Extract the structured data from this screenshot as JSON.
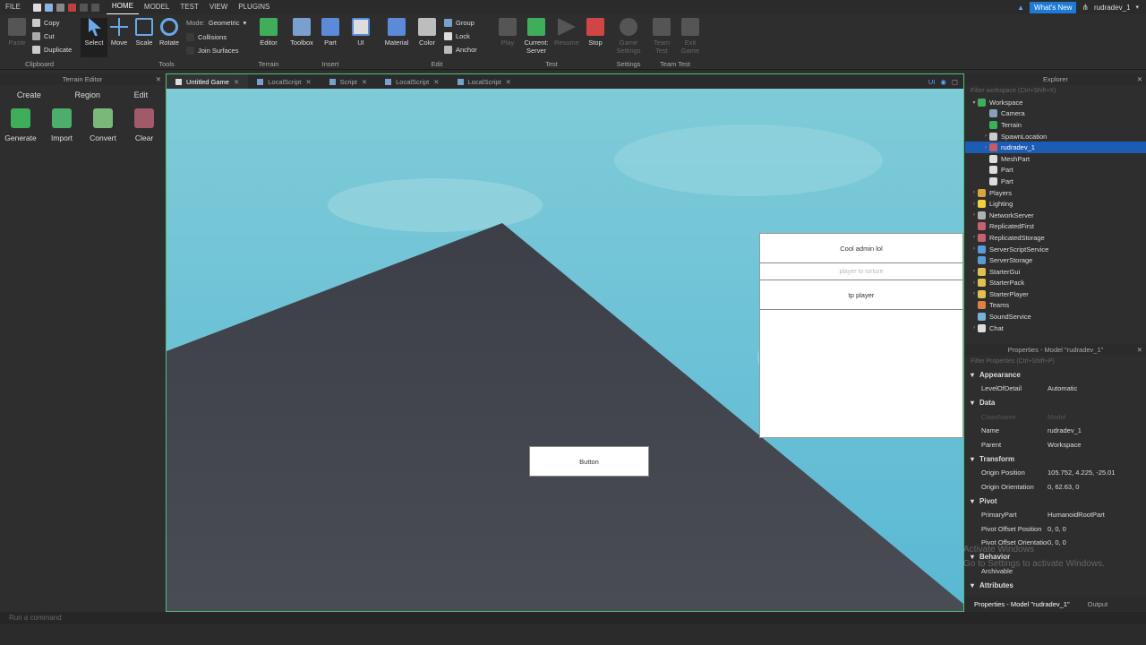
{
  "topbar": {
    "menu": [
      "FILE",
      "HOME",
      "MODEL",
      "TEST",
      "VIEW",
      "PLUGINS"
    ],
    "active_menu": "HOME",
    "whats_new": "What's New",
    "username": "rudradev_1"
  },
  "ribbon": {
    "clipboard": {
      "label": "Clipboard",
      "paste": "Paste",
      "copy": "Copy",
      "cut": "Cut",
      "duplicate": "Duplicate"
    },
    "tools": {
      "label": "Tools",
      "select": "Select",
      "move": "Move",
      "scale": "Scale",
      "rotate": "Rotate",
      "mode_label": "Mode:",
      "mode_value": "Geometric",
      "collisions": "Collisions",
      "join_surfaces": "Join Surfaces"
    },
    "terrain": {
      "label": "Terrain",
      "editor": "Editor"
    },
    "insert": {
      "label": "Insert",
      "toolbox": "Toolbox",
      "part": "Part",
      "ui": "UI"
    },
    "edit": {
      "label": "Edit",
      "material": "Material",
      "color": "Color",
      "group": "Group",
      "lock": "Lock",
      "anchor": "Anchor"
    },
    "test": {
      "label": "Test",
      "play": "Play",
      "current_server": "Current:",
      "server": "Server",
      "resume": "Resume",
      "stop": "Stop"
    },
    "settings": {
      "label": "Settings",
      "game_settings": "Game Settings"
    },
    "team_test": {
      "label": "Team Test",
      "team_test": "Team Test",
      "exit_game": "Exit Game"
    }
  },
  "terrain_editor": {
    "title": "Terrain Editor",
    "tabs": [
      "Create",
      "Region",
      "Edit"
    ],
    "tools": [
      "Generate",
      "Import",
      "Convert",
      "Clear"
    ]
  },
  "doc_tabs": [
    {
      "label": "Untitled Game",
      "active": true
    },
    {
      "label": "LocalScript",
      "active": false
    },
    {
      "label": "Script",
      "active": false
    },
    {
      "label": "LocalScript",
      "active": false
    },
    {
      "label": "LocalScript",
      "active": false
    }
  ],
  "viewport": {
    "ui_toggle": "UI",
    "admin_panel": {
      "title": "Cool admin lol",
      "placeholder": "player to torture",
      "tp_button": "tp player"
    },
    "game_button": "Button"
  },
  "explorer": {
    "title": "Explorer",
    "filter_placeholder": "Filter workspace (Ctrl+Shift+X)",
    "items": [
      {
        "label": "Workspace",
        "depth": 0,
        "arrow": "▾",
        "color": "#3fae5a",
        "selected": false
      },
      {
        "label": "Camera",
        "depth": 1,
        "arrow": "",
        "color": "#8aa0b8",
        "selected": false
      },
      {
        "label": "Terrain",
        "depth": 1,
        "arrow": "",
        "color": "#3fae5a",
        "selected": false
      },
      {
        "label": "SpawnLocation",
        "depth": 1,
        "arrow": "›",
        "color": "#cccccc",
        "selected": false
      },
      {
        "label": "rudradev_1",
        "depth": 1,
        "arrow": "›",
        "color": "#c85a6a",
        "selected": true
      },
      {
        "label": "MeshPart",
        "depth": 1,
        "arrow": "",
        "color": "#dddddd",
        "selected": false
      },
      {
        "label": "Part",
        "depth": 1,
        "arrow": "",
        "color": "#dddddd",
        "selected": false
      },
      {
        "label": "Part",
        "depth": 1,
        "arrow": "",
        "color": "#dddddd",
        "selected": false
      },
      {
        "label": "Players",
        "depth": 0,
        "arrow": "›",
        "color": "#d9a43a",
        "selected": false
      },
      {
        "label": "Lighting",
        "depth": 0,
        "arrow": "›",
        "color": "#f0d040",
        "selected": false
      },
      {
        "label": "NetworkServer",
        "depth": 0,
        "arrow": "›",
        "color": "#b0b0b0",
        "selected": false
      },
      {
        "label": "ReplicatedFirst",
        "depth": 0,
        "arrow": "",
        "color": "#c86070",
        "selected": false
      },
      {
        "label": "ReplicatedStorage",
        "depth": 0,
        "arrow": "›",
        "color": "#c86070",
        "selected": false
      },
      {
        "label": "ServerScriptService",
        "depth": 0,
        "arrow": "›",
        "color": "#5a9ad8",
        "selected": false
      },
      {
        "label": "ServerStorage",
        "depth": 0,
        "arrow": "",
        "color": "#5a9ad8",
        "selected": false
      },
      {
        "label": "StarterGui",
        "depth": 0,
        "arrow": "›",
        "color": "#e0c050",
        "selected": false
      },
      {
        "label": "StarterPack",
        "depth": 0,
        "arrow": "›",
        "color": "#e0c050",
        "selected": false
      },
      {
        "label": "StarterPlayer",
        "depth": 0,
        "arrow": "›",
        "color": "#e0c050",
        "selected": false
      },
      {
        "label": "Teams",
        "depth": 0,
        "arrow": "",
        "color": "#e08040",
        "selected": false
      },
      {
        "label": "SoundService",
        "depth": 0,
        "arrow": "",
        "color": "#7ab0d8",
        "selected": false
      },
      {
        "label": "Chat",
        "depth": 0,
        "arrow": "›",
        "color": "#dddddd",
        "selected": false
      }
    ]
  },
  "properties": {
    "title": "Properties - Model \"rudradev_1\"",
    "filter_placeholder": "Filter Properties (Ctrl+Shift+P)",
    "sections": [
      {
        "name": "Appearance",
        "rows": [
          {
            "k": "LevelOfDetail",
            "v": "Automatic",
            "dim": false
          }
        ]
      },
      {
        "name": "Data",
        "rows": [
          {
            "k": "ClassName",
            "v": "Model",
            "dim": true
          },
          {
            "k": "Name",
            "v": "rudradev_1",
            "dim": false
          },
          {
            "k": "Parent",
            "v": "Workspace",
            "dim": false
          }
        ]
      },
      {
        "name": "Transform",
        "rows": [
          {
            "k": "Origin Position",
            "v": "105.752, 4.225, -25.01",
            "dim": false
          },
          {
            "k": "Origin Orientation",
            "v": "0, 62.63, 0",
            "dim": false
          }
        ]
      },
      {
        "name": "Pivot",
        "rows": [
          {
            "k": "PrimaryPart",
            "v": "HumanoidRootPart",
            "dim": false
          },
          {
            "k": "Pivot Offset Position",
            "v": "0, 0, 0",
            "dim": false
          },
          {
            "k": "Pivot Offset Orientation",
            "v": "0, 0, 0",
            "dim": false
          }
        ]
      },
      {
        "name": "Behavior",
        "rows": [
          {
            "k": "Archivable",
            "v": "",
            "dim": false
          }
        ]
      },
      {
        "name": "Attributes",
        "rows": []
      }
    ]
  },
  "bottom_tabs": [
    {
      "label": "Properties - Model \"rudradev_1\"",
      "active": true
    },
    {
      "label": "Output",
      "active": false
    }
  ],
  "command_bar": {
    "placeholder": "Run a command"
  },
  "watermark": {
    "line1": "Activate Windows",
    "line2": "Go to Settings to activate Windows."
  }
}
